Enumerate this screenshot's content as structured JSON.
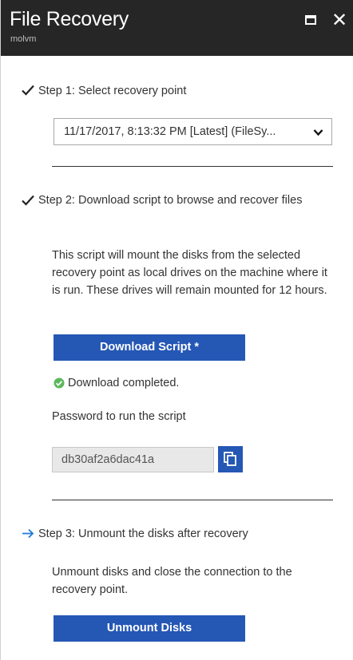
{
  "header": {
    "title": "File Recovery",
    "subtitle": "molvm"
  },
  "step1": {
    "label": "Step 1: Select recovery point",
    "selected_point": "11/17/2017, 8:13:32 PM [Latest] (FileSy..."
  },
  "step2": {
    "label": "Step 2: Download script to browse and recover files",
    "description": "This script will mount the disks from the selected recovery point as local drives on the machine where it is run. These drives will remain mounted for 12 hours.",
    "download_button": "Download Script *",
    "status": "Download completed.",
    "password_label": "Password to run the script",
    "password_value": "db30af2a6dac41a"
  },
  "step3": {
    "label": "Step 3: Unmount the disks after recovery",
    "description": "Unmount disks and close the connection to the recovery point.",
    "unmount_button": "Unmount Disks"
  },
  "colors": {
    "header_bg": "#262626",
    "primary": "#2557b5",
    "success": "#5cb85c",
    "step3_arrow": "#1f7bd8"
  }
}
